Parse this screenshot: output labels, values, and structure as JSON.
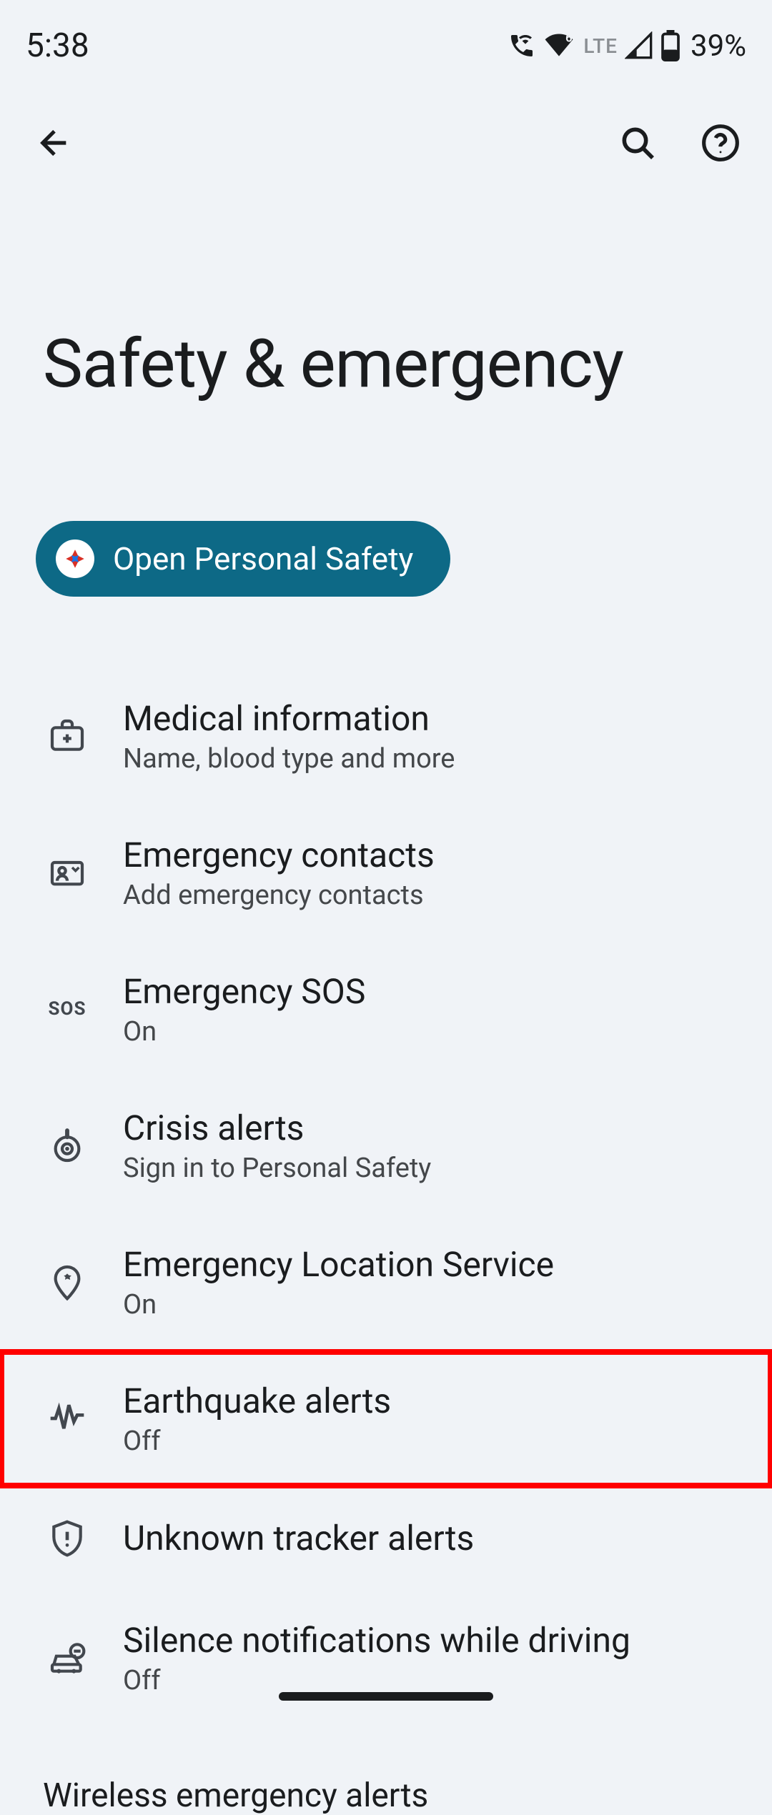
{
  "status": {
    "time": "5:38",
    "lte": "LTE",
    "battery_pct": "39%"
  },
  "page": {
    "title": "Safety & emergency"
  },
  "action_chip": {
    "label": "Open Personal Safety"
  },
  "settings": [
    {
      "title": "Medical information",
      "sub": "Name, blood type and more"
    },
    {
      "title": "Emergency contacts",
      "sub": "Add emergency contacts"
    },
    {
      "title": "Emergency SOS",
      "sub": "On"
    },
    {
      "title": "Crisis alerts",
      "sub": "Sign in to Personal Safety"
    },
    {
      "title": "Emergency Location Service",
      "sub": "On"
    },
    {
      "title": "Earthquake alerts",
      "sub": "Off"
    },
    {
      "title": "Unknown tracker alerts",
      "sub": ""
    },
    {
      "title": "Silence notifications while driving",
      "sub": "Off"
    }
  ],
  "section": {
    "wireless_alerts": "Wireless emergency alerts"
  },
  "highlighted_index": 5
}
